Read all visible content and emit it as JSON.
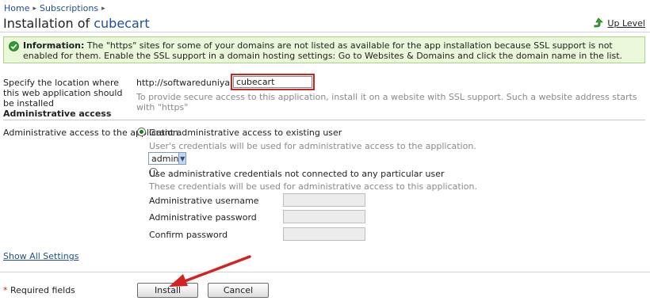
{
  "breadcrumb": {
    "home": "Home",
    "subscriptions": "Subscriptions"
  },
  "header": {
    "title_prefix": "Installation of ",
    "title_app": "cubecart",
    "up_level": "Up Level"
  },
  "info": {
    "label": "Information:",
    "text": " The \"https\" sites for some of your domains are not listed as available for the app installation because SSL support is not enabled for them. Enable the SSL support in a domain hosting settings: Go to Websites & Domains and click the domain name in the list."
  },
  "location": {
    "label": "Specify the location where this web application should be installed",
    "url_prefix": "http://softwareduniya.com /",
    "path_value": "cubecart",
    "hint": "To provide secure access to this application, install it on a website with SSL support. Such a website address starts with \"https\""
  },
  "admin": {
    "section_title": "Administrative access",
    "label": "Administrative access to the application",
    "option_existing": "Grant administrative access to existing user",
    "existing_hint": "User's credentials will be used for administrative access to the application.",
    "selected_user": "admin",
    "option_custom": "Use administrative credentials not connected to any particular user",
    "custom_hint": "These credentials will be used for administrative access to this application.",
    "username_label": "Administrative username",
    "password_label": "Administrative password",
    "confirm_label": "Confirm password"
  },
  "links": {
    "show_all": "Show All Settings"
  },
  "footer": {
    "required_star": "*",
    "required_text": " Required fields",
    "install": "Install",
    "cancel": "Cancel"
  },
  "colors": {
    "link": "#1f4e9b",
    "info_bg": "#eaf7d8",
    "highlight": "#d02020"
  }
}
